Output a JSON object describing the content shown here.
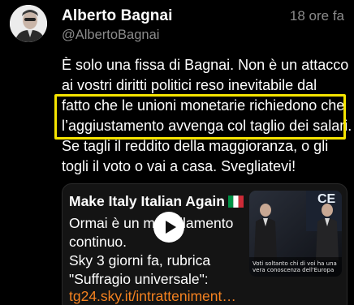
{
  "tweet": {
    "author_name": "Alberto Bagnai",
    "author_handle": "@AlbertoBagnai",
    "timestamp": "18 ore fa",
    "lines": [
      "È solo una fissa di Bagnai. Non è un attacco",
      "ai vostri diritti politici reso inevitabile dal",
      "fatto che le unioni monetarie richiedono che",
      "l’aggiustamento avvenga col taglio dei salari.",
      "Se tagli il reddito della maggioranza, o gli",
      "togli il voto o vai a casa. Svegliatevi!"
    ],
    "highlight_color": "#f5e400"
  },
  "link_card": {
    "title": "Make Italy Italian Again",
    "flag_icon": "italian-flag-icon",
    "description_lines": [
      "Ormai è un martellamento",
      "continuo.",
      "Sky 3 giorni fa, rubrica",
      "\"Suffragio universale\":"
    ],
    "link_text": "tg24.sky.it/intratteniment…",
    "link_color": "#f58220",
    "thumbnail": {
      "overlay_text": "CE",
      "caption": "Voti soltanto chi di voi ha una vera conoscenza dell'Europa",
      "play_icon": "play-icon"
    }
  }
}
